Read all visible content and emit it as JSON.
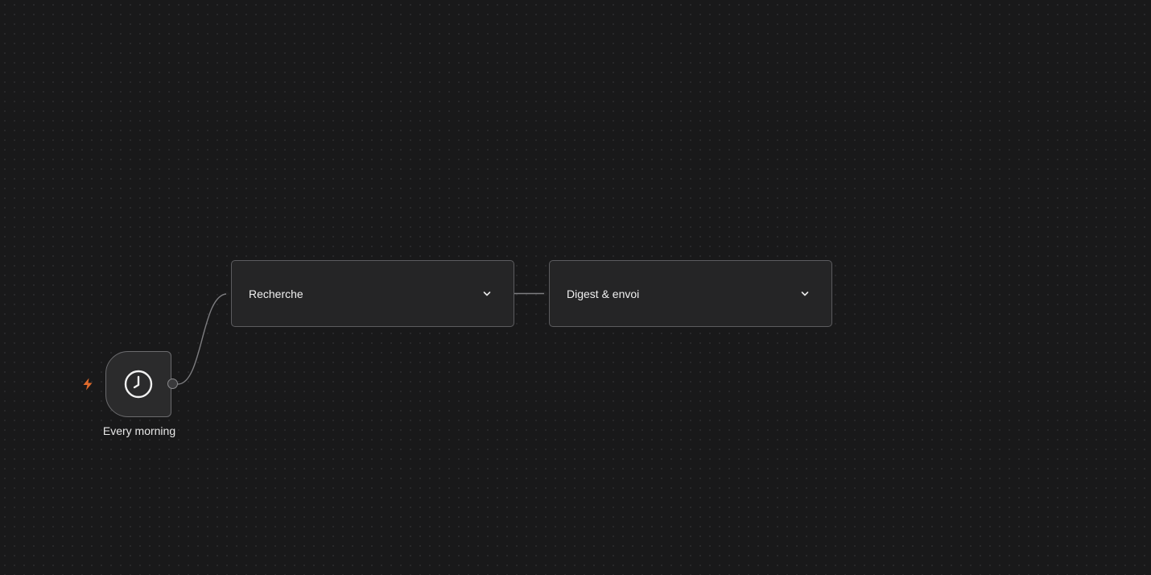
{
  "trigger": {
    "label": "Every morning",
    "icon": "clock-icon",
    "badge_icon": "lightning-bolt-icon",
    "badge_color": "#e06a2c"
  },
  "steps": [
    {
      "title": "Recherche",
      "toggle_icon": "chevron-down-icon"
    },
    {
      "title": "Digest & envoi",
      "toggle_icon": "chevron-down-icon"
    }
  ],
  "colors": {
    "canvas_background": "#19191a",
    "node_background": "#252526",
    "node_border": "#5c5c5f",
    "edge": "#8a8a8d",
    "text": "#f0f0f0"
  }
}
